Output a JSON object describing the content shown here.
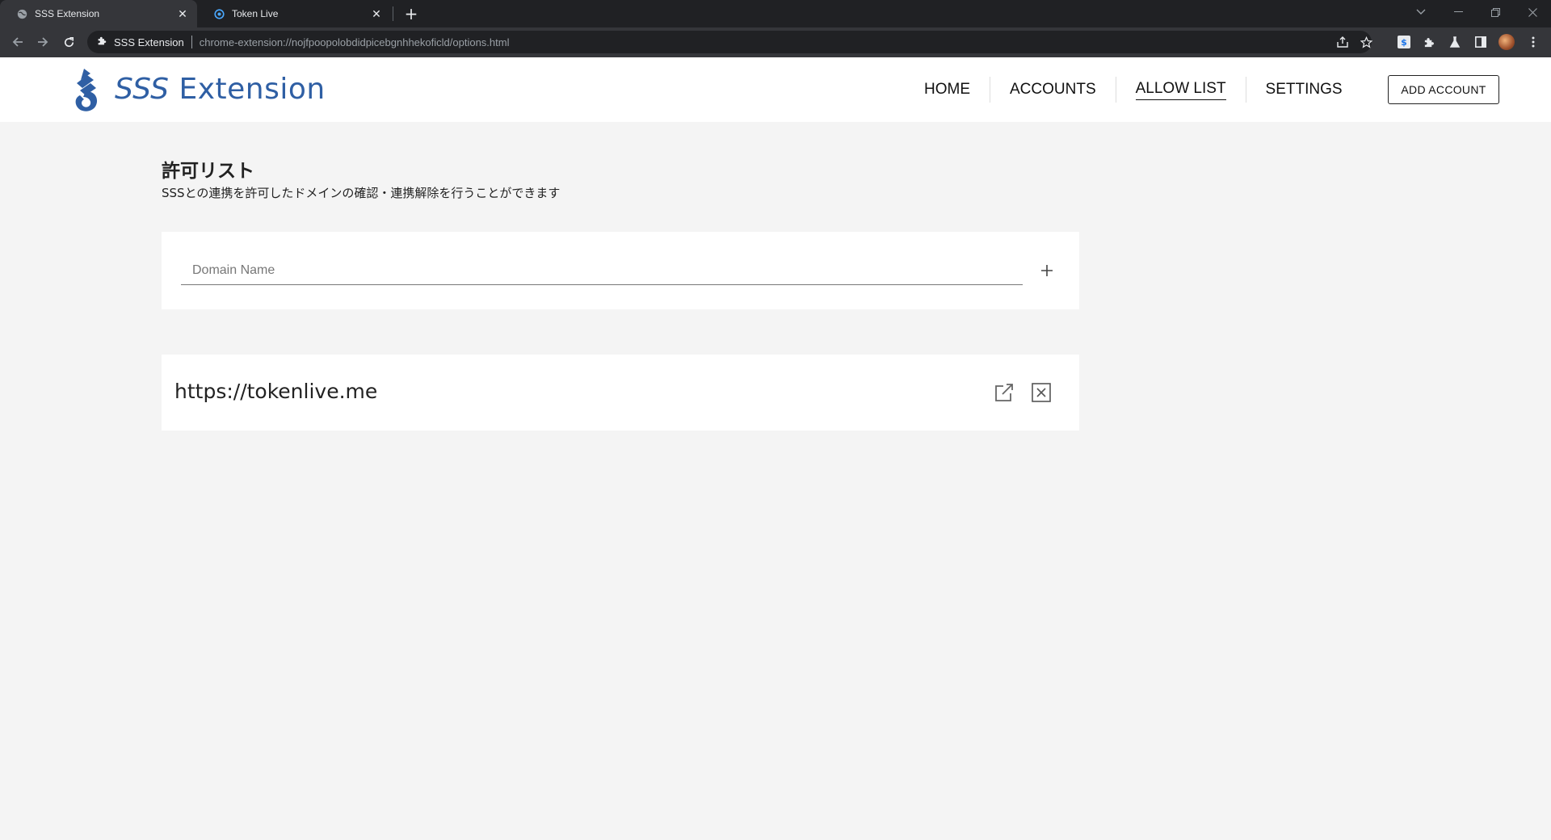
{
  "browser": {
    "tabs": [
      {
        "title": "SSS Extension",
        "favicon": "globe-icon",
        "active": true
      },
      {
        "title": "Token Live",
        "favicon": "token-live-icon",
        "active": false
      }
    ],
    "omnibox": {
      "site_label": "SSS Extension",
      "url": "chrome-extension://nojfpoopolobdidpicebgnhhekoficld/options.html"
    }
  },
  "app": {
    "brand": {
      "prefix": "SSS",
      "suffix": "Extension",
      "color": "#2f5fa4"
    },
    "nav": [
      {
        "label": "HOME",
        "active": false
      },
      {
        "label": "ACCOUNTS",
        "active": false
      },
      {
        "label": "ALLOW LIST",
        "active": true
      },
      {
        "label": "SETTINGS",
        "active": false
      }
    ],
    "add_account_label": "ADD ACCOUNT"
  },
  "page": {
    "title": "許可リスト",
    "description": "SSSとの連携を許可したドメインの確認・連携解除を行うことができます",
    "domain_input": {
      "placeholder": "Domain Name",
      "value": ""
    },
    "allow_list": [
      {
        "url": "https://tokenlive.me"
      }
    ]
  }
}
